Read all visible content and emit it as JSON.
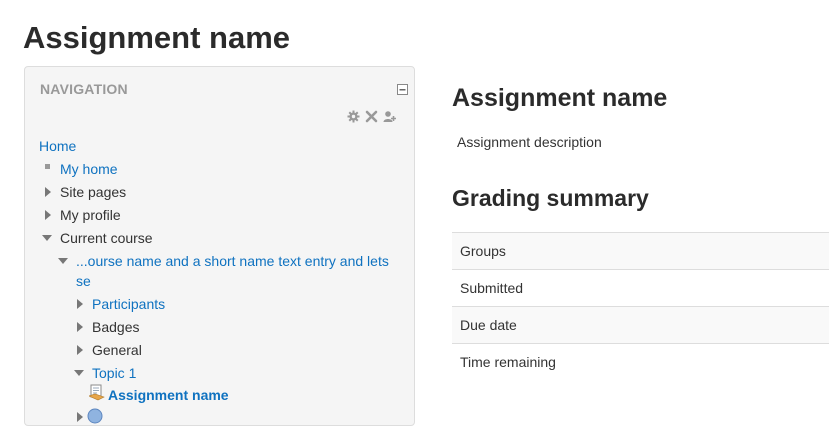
{
  "page": {
    "title": "Assignment name"
  },
  "navigation": {
    "header": "NAVIGATION",
    "items": [
      {
        "label": "Home"
      },
      {
        "label": "My home"
      },
      {
        "label": "Site pages"
      },
      {
        "label": "My profile"
      },
      {
        "label": "Current course"
      },
      {
        "label": "...ourse name and a short name text entry and lets"
      },
      {
        "label": "se"
      },
      {
        "label": "Participants"
      },
      {
        "label": "Badges"
      },
      {
        "label": "General"
      },
      {
        "label": "Topic 1"
      },
      {
        "label": "Assignment name"
      }
    ]
  },
  "main": {
    "heading": "Assignment name",
    "description": "Assignment description",
    "grading_heading": "Grading summary",
    "table_rows": [
      {
        "label": "Groups"
      },
      {
        "label": "Submitted"
      },
      {
        "label": "Due date"
      },
      {
        "label": "Time remaining"
      }
    ]
  },
  "colors": {
    "link": "#0f72c0",
    "heading": "#2b2b2b",
    "text": "#333333",
    "muted": "#999999"
  },
  "icons": [
    "collapse-icon",
    "gear-icon",
    "close-icon",
    "add-user-icon",
    "assignment-icon",
    "quiz-icon"
  ]
}
